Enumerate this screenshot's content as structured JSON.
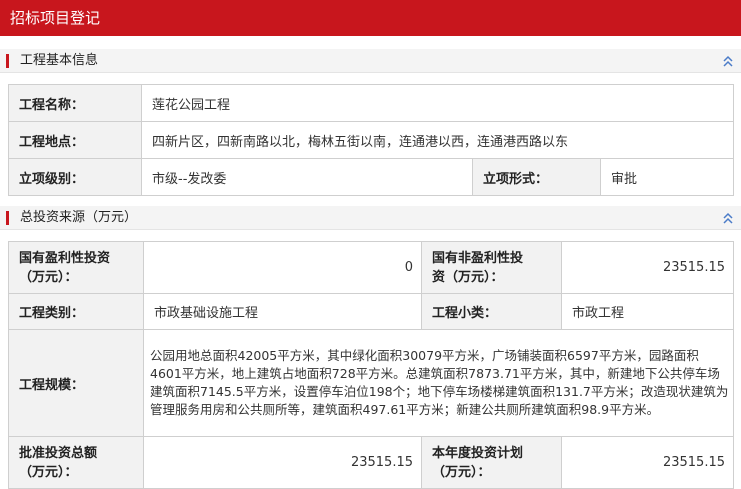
{
  "header": {
    "title": "招标项目登记"
  },
  "section1": {
    "title": "工程基本信息",
    "rows": {
      "name_label": "工程名称：",
      "name_value": "莲花公园工程",
      "location_label": "工程地点：",
      "location_value": "四新片区，四新南路以北，梅林五街以南，连通港以西，连通港西路以东",
      "level_label": "立项级别：",
      "level_value": "市级--发改委",
      "form_label": "立项形式：",
      "form_value": "审批"
    }
  },
  "section2": {
    "title": "总投资来源（万元）",
    "rows": {
      "state_profit_label_1": "国有盈利性投资",
      "state_profit_label_2": "（万元）：",
      "state_profit_value": "0",
      "state_nonprofit_label_1": "国有非盈利性投",
      "state_nonprofit_label_2": "资（万元）：",
      "state_nonprofit_value": "23515.15",
      "category_label": "工程类别：",
      "category_value": "市政基础设施工程",
      "subcategory_label": "工程小类：",
      "subcategory_value": "市政工程",
      "scale_label": "工程规模：",
      "scale_value": "公园用地总面积42005平方米，其中绿化面积30079平方米，广场铺装面积6597平方米，园路面积4601平方米，地上建筑占地面积728平方米。总建筑面积7873.71平方米，其中，新建地下公共停车场建筑面积7145.5平方米，设置停车泊位198个；地下停车场楼梯建筑面积131.7平方米；改造现状建筑为管理服务用房和公共厕所等，建筑面积497.61平方米；新建公共厕所建筑面积98.9平方米。",
      "approved_label_1": "批准投资总额",
      "approved_label_2": "（万元）：",
      "approved_value": "23515.15",
      "annual_label_1": "本年度投资计划",
      "annual_label_2": "（万元）：",
      "annual_value": "23515.15"
    }
  },
  "icons": {
    "collapse": "double-chevron-up-icon"
  },
  "colors": {
    "accent": "#c8161d",
    "label_bg": "#f2f2f2",
    "border": "#cfcfcf",
    "icon": "#4a7bc8"
  }
}
